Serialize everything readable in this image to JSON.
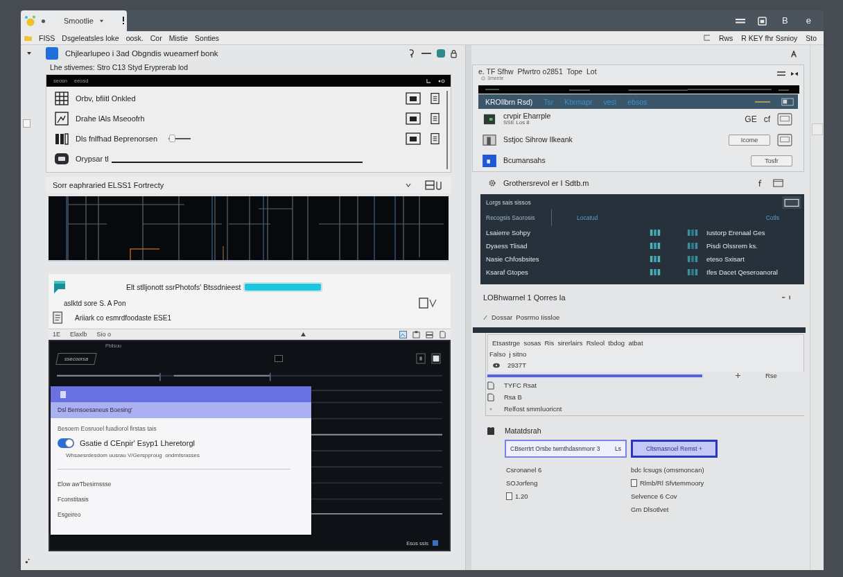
{
  "window": {
    "tab_title": "Smootlie",
    "toolbar_buttons": [
      "B",
      "e"
    ]
  },
  "menu_bar": {
    "left_items": [
      "FISS",
      "Dsgeleatsles loke",
      "oosk.",
      "Cor",
      "Mistie",
      "Sonties"
    ],
    "right_items": [
      "Rws",
      "R KEY fhr Ssnioy",
      "Sto"
    ]
  },
  "left_pane": {
    "header": {
      "title": "Chjlearlupeo i 3ad Obgndis wueamerf bonk",
      "subtitle": "Lhe stivemes: Stro C13 Styd Eryprerab lod"
    },
    "list_panel": {
      "header_labels": [
        "seosn",
        "eeosd"
      ],
      "checkbox": {
        "checked": false
      },
      "rows": [
        {
          "kind": "actions",
          "label": "Orbv, bfiitl Onkled"
        },
        {
          "kind": "actions",
          "label": "Drahe lAls Mseoofrh"
        },
        {
          "kind": "slider",
          "label": "Dls fnlfhad Beprenorsen",
          "level": 0.15
        },
        {
          "kind": "rule",
          "label": "Orypsar tl"
        }
      ]
    },
    "section_title": "Sorr eaphraried ELSS1 Fortrecty",
    "attachments": {
      "progress": {
        "label": "Elt stlljonott ssrPhotofs' Btssdnieest",
        "level": 1
      },
      "rows": [
        "aslktd sore S. A Pon",
        "Ariiark co esmrdfoodaste ESE1"
      ]
    },
    "status_bar": [
      "1E",
      "Elaxlb",
      "Sio o"
    ],
    "dark_panel": {
      "header": "Pblisuu",
      "tab_label": "ssecoorsa",
      "footer": "Esos ssis",
      "dialog": {
        "subheader": "Dsl Bemsoesaneus Boesing'",
        "description": "Besoem Eosruoel fuadiorol firstas tais",
        "toggle": {
          "title": "Gsatie d CEnpir' Esyp1 Lheretorgl",
          "subtitle": "Whsaesrdesdom uusrau V/Gerspproug  ondmtsrasses",
          "on": true
        },
        "options": [
          "Elow awTbesirnssse",
          "Fconstitasis",
          "Esgeireo"
        ]
      }
    }
  },
  "right_pane": {
    "card": {
      "title": "e. TF Sfhw  Pfwrtro o2851  Tope  Lot",
      "subtitle": "3meete",
      "tabs": [
        {
          "label": "KROIlbrn Rsd)",
          "selected": true
        },
        {
          "label": "Tsr",
          "selected": false
        },
        {
          "label": "Kbrmapr",
          "selected": false
        },
        {
          "label": "vesl",
          "selected": false
        },
        {
          "label": "ebsos",
          "selected": false
        }
      ],
      "items": [
        {
          "title": "crvpir Eharrple",
          "subtitle": "SSE Los 8",
          "actions": [
            {
              "kind": "text",
              "label": "GE"
            },
            {
              "kind": "text",
              "label": "cf"
            },
            {
              "kind": "icon"
            }
          ]
        },
        {
          "title": "Sstjoc Sihrow Ilkeank",
          "actions": [
            {
              "kind": "button",
              "label": "Icome"
            },
            {
              "kind": "icon"
            }
          ]
        },
        {
          "title": "Bcumansahs",
          "actions": [
            {
              "kind": "button",
              "label": "Tosfr"
            }
          ]
        }
      ]
    },
    "section_row": "Grothersrevol er I Sdtb.m",
    "table": {
      "title": "Lorgs sais sissos",
      "columns": [
        "Recogsis Saorosis",
        "Locatud",
        "Cotls"
      ],
      "rows": [
        {
          "name": "Lsaierre Sohpy",
          "detail": "Iustorp Erenaal Ges"
        },
        {
          "name": "Dyaess Tlisad",
          "detail": "Pisdi Olssrern ks."
        },
        {
          "name": "Nasie Chfosbsites",
          "detail": "eteso Sxisart"
        },
        {
          "name": "Ksaraf Gtopes",
          "detail": "Ifes Dacet Qeseroanoral"
        }
      ]
    },
    "notice": {
      "title": "LOBhwarnel 1 Qorres Ia",
      "line": "Dossar  Posrrno Iissloe"
    },
    "summary": {
      "text": "Etsastrge  sosas  Ris  sirerlairs  Rsleol  tbdog  atbat",
      "meta": "Falso  ɉ sitno",
      "code": "2937T",
      "progress": {
        "level": 1,
        "reading": "Rse"
      },
      "items": [
        "TYFC Rsat",
        "Rsa B",
        "Relfost smmluoricnt"
      ]
    },
    "form": {
      "title": "Matatdsrah",
      "input": {
        "value": "CBserrtrt Orsbe twmthdasnmonr 3",
        "suffix": "Ls"
      },
      "button": "Cltsmasnoel Remst +",
      "left_list": [
        {
          "kind": "plain",
          "label": "Csronanel 6"
        },
        {
          "kind": "plain",
          "label": "SOJorfeng"
        },
        {
          "kind": "check",
          "label": "1.20",
          "checked": false
        }
      ],
      "right_list": [
        {
          "kind": "plain",
          "label": "bdc lcsugs (omsmoncan)"
        },
        {
          "kind": "check",
          "label": "Rlmb/Rl Sfvtemmoory",
          "checked": false
        },
        {
          "kind": "plain",
          "label": "Selvence 6 Cov"
        },
        {
          "kind": "plain",
          "label": "Gm Dlsotlvet"
        }
      ]
    }
  }
}
